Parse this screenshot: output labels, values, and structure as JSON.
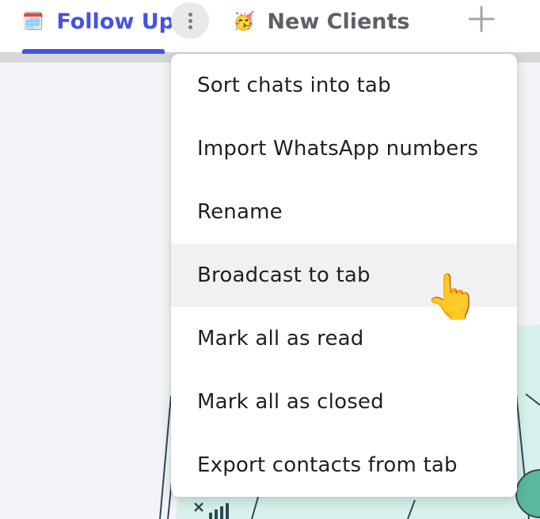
{
  "tabs": [
    {
      "label": "Follow Up",
      "emoji": "🗓️",
      "active": true
    },
    {
      "label": "New Clients",
      "emoji": "🥳",
      "active": false
    }
  ],
  "colors": {
    "accent": "#4653e0",
    "menu_hover": "#f1f1f4",
    "illustration_fill": "#d8f1ec"
  },
  "icons": {
    "kebab": "more-vertical-icon",
    "add_tab": "plus-icon",
    "cursor": "pointing-hand-icon"
  },
  "menu": {
    "items": [
      {
        "label": "Sort chats into tab"
      },
      {
        "label": "Import WhatsApp numbers"
      },
      {
        "label": "Rename"
      },
      {
        "label": "Broadcast to tab",
        "hovered": true
      },
      {
        "label": "Mark all as read"
      },
      {
        "label": "Mark all as closed"
      },
      {
        "label": "Export contacts from tab"
      }
    ]
  },
  "cursor_glyph": "👆"
}
